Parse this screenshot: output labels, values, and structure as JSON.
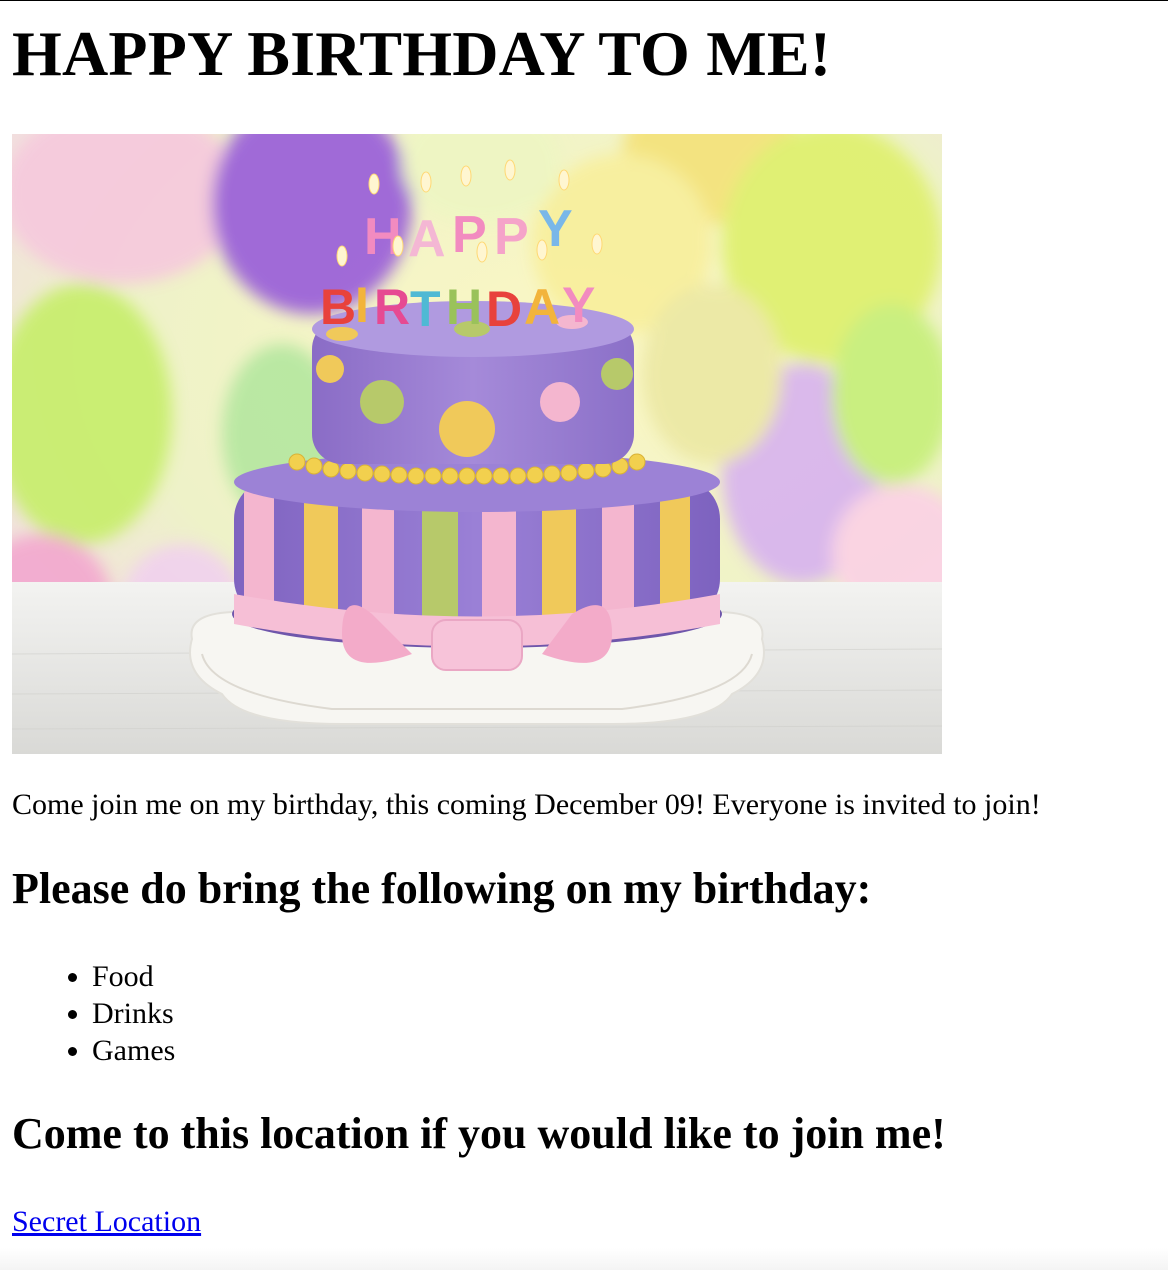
{
  "page": {
    "title": "HAPPY BIRTHDAY TO ME!",
    "image": {
      "cake_topper_line1": "HAPPY",
      "cake_topper_line2": "BIRTHDAY"
    },
    "intro": "Come join me on my birthday, this coming December 09! Everyone is invited to join!",
    "bring_heading": "Please do bring the following on my birthday:",
    "bring_items": [
      "Food",
      "Drinks",
      "Games"
    ],
    "location_heading": "Come to this location if you would like to join me!",
    "location_link": "Secret Location"
  },
  "colors": {
    "text": "#000000",
    "link": "#0000ee",
    "background": "#ffffff",
    "cake_purple": "#9b7fd4",
    "cake_pink": "#f4b6cf",
    "cake_yellow": "#f0c95a",
    "cake_green": "#b7c96a"
  }
}
